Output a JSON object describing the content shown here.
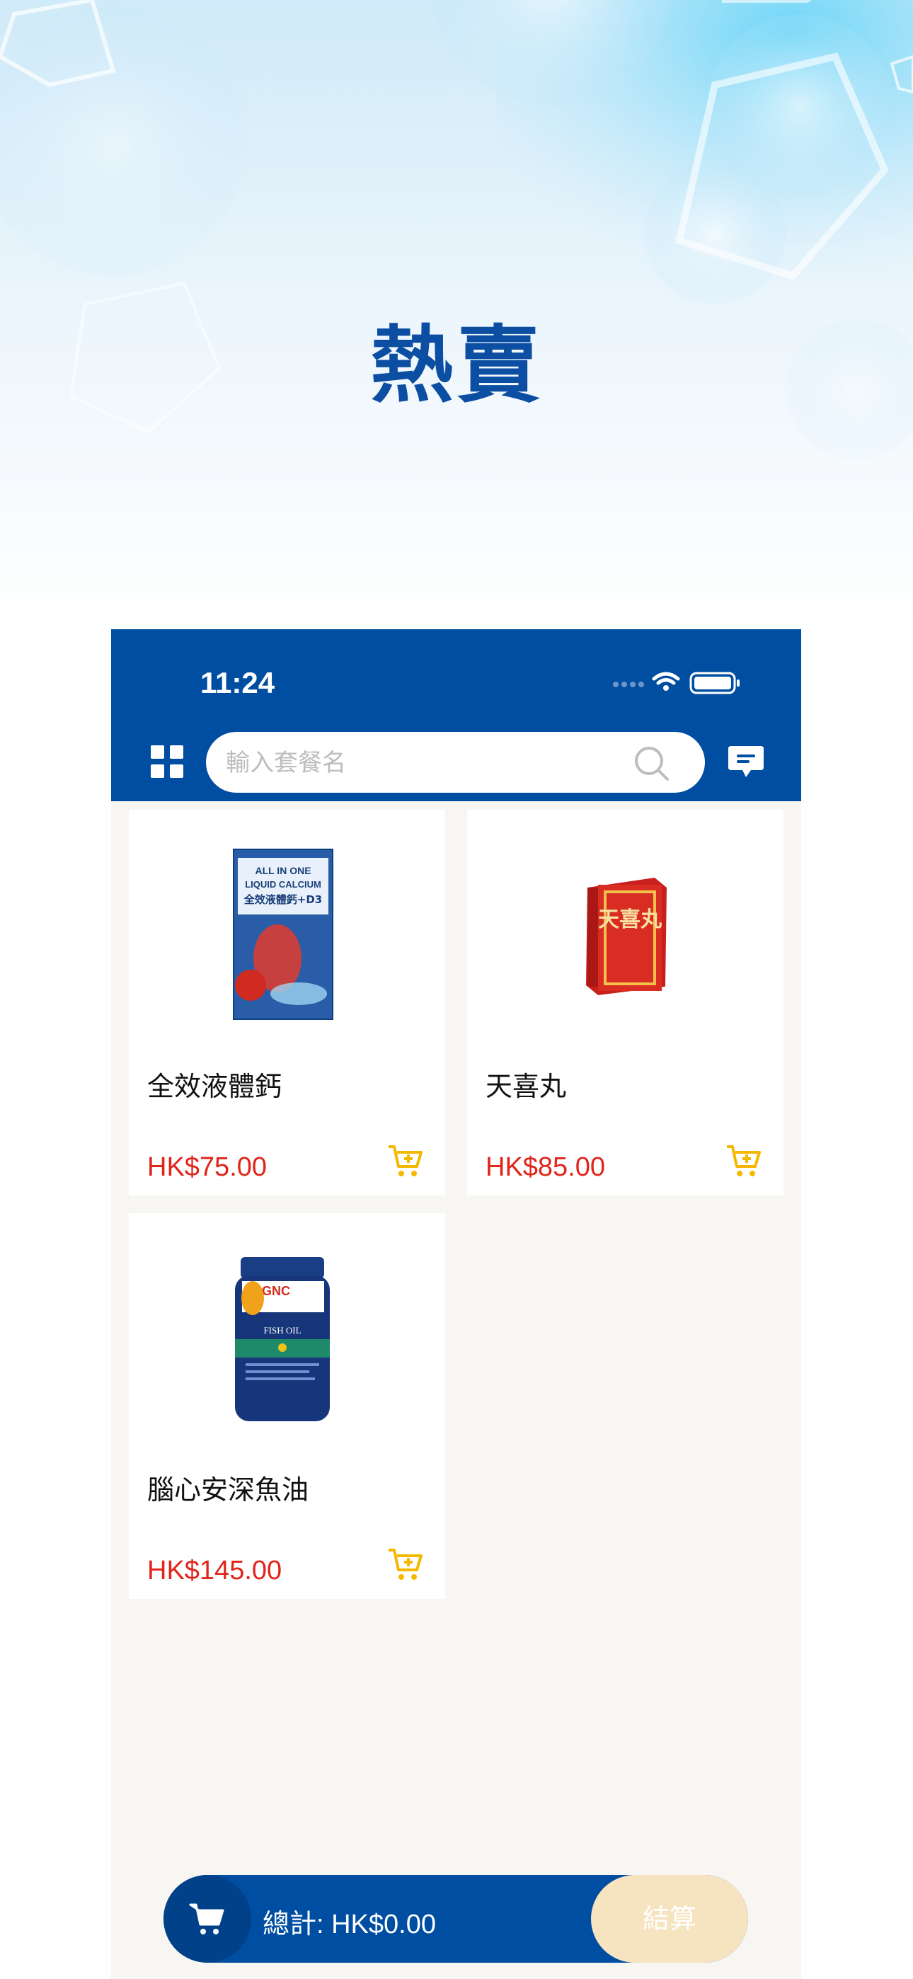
{
  "hero": {
    "title": "熱賣"
  },
  "status_bar": {
    "time": "11:24"
  },
  "search": {
    "placeholder": "輸入套餐名"
  },
  "colors": {
    "brand": "#004ea2",
    "price": "#e0251b",
    "cart_icon": "#f5b800",
    "checkout_bg": "#f6e3bf"
  },
  "products": [
    {
      "name": "全效液體鈣",
      "price": "HK$75.00",
      "image": "calcium-box-image"
    },
    {
      "name": "天喜丸",
      "price": "HK$85.00",
      "image": "herbal-pill-box-image"
    },
    {
      "name": "腦心安深魚油",
      "price": "HK$145.00",
      "image": "fish-oil-bottle-image"
    }
  ],
  "product_image_text": {
    "calcium": [
      "ALL IN ONE",
      "LIQUID CALCIUM",
      "全效液體鈣+D3"
    ],
    "herbal": [
      "天喜丸"
    ],
    "fish_oil": [
      "GNC",
      "FISH OIL"
    ]
  },
  "bottom_bar": {
    "total_label": "總計: HK$0.00",
    "checkout_label": "結算"
  }
}
